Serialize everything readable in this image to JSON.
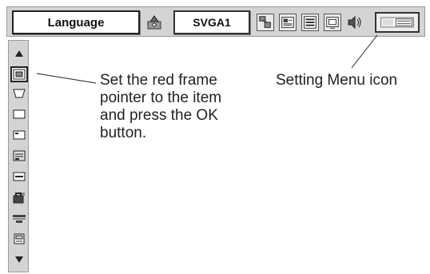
{
  "topbar": {
    "language_label": "Language",
    "input_label": "SVGA1",
    "icons": [
      "sound-icon",
      "pc-adjust-icon",
      "image-select-icon",
      "image-adjust-icon",
      "screen-icon",
      "volume-icon"
    ],
    "setting_icon": "setting-menu-icon"
  },
  "sidebar": {
    "icons": [
      "up-arrow-icon",
      "position-icon",
      "keystone-icon",
      "blank-icon",
      "logo-icon",
      "menu-position-icon",
      "on-start-icon",
      "lock-icon",
      "terminal-icon",
      "power-management-icon",
      "down-arrow-icon"
    ],
    "selected": "position-icon"
  },
  "callouts": {
    "instruction": "Set the red frame\npointer to the item\nand press the OK\nbutton.",
    "setting_menu": "Setting Menu icon"
  }
}
